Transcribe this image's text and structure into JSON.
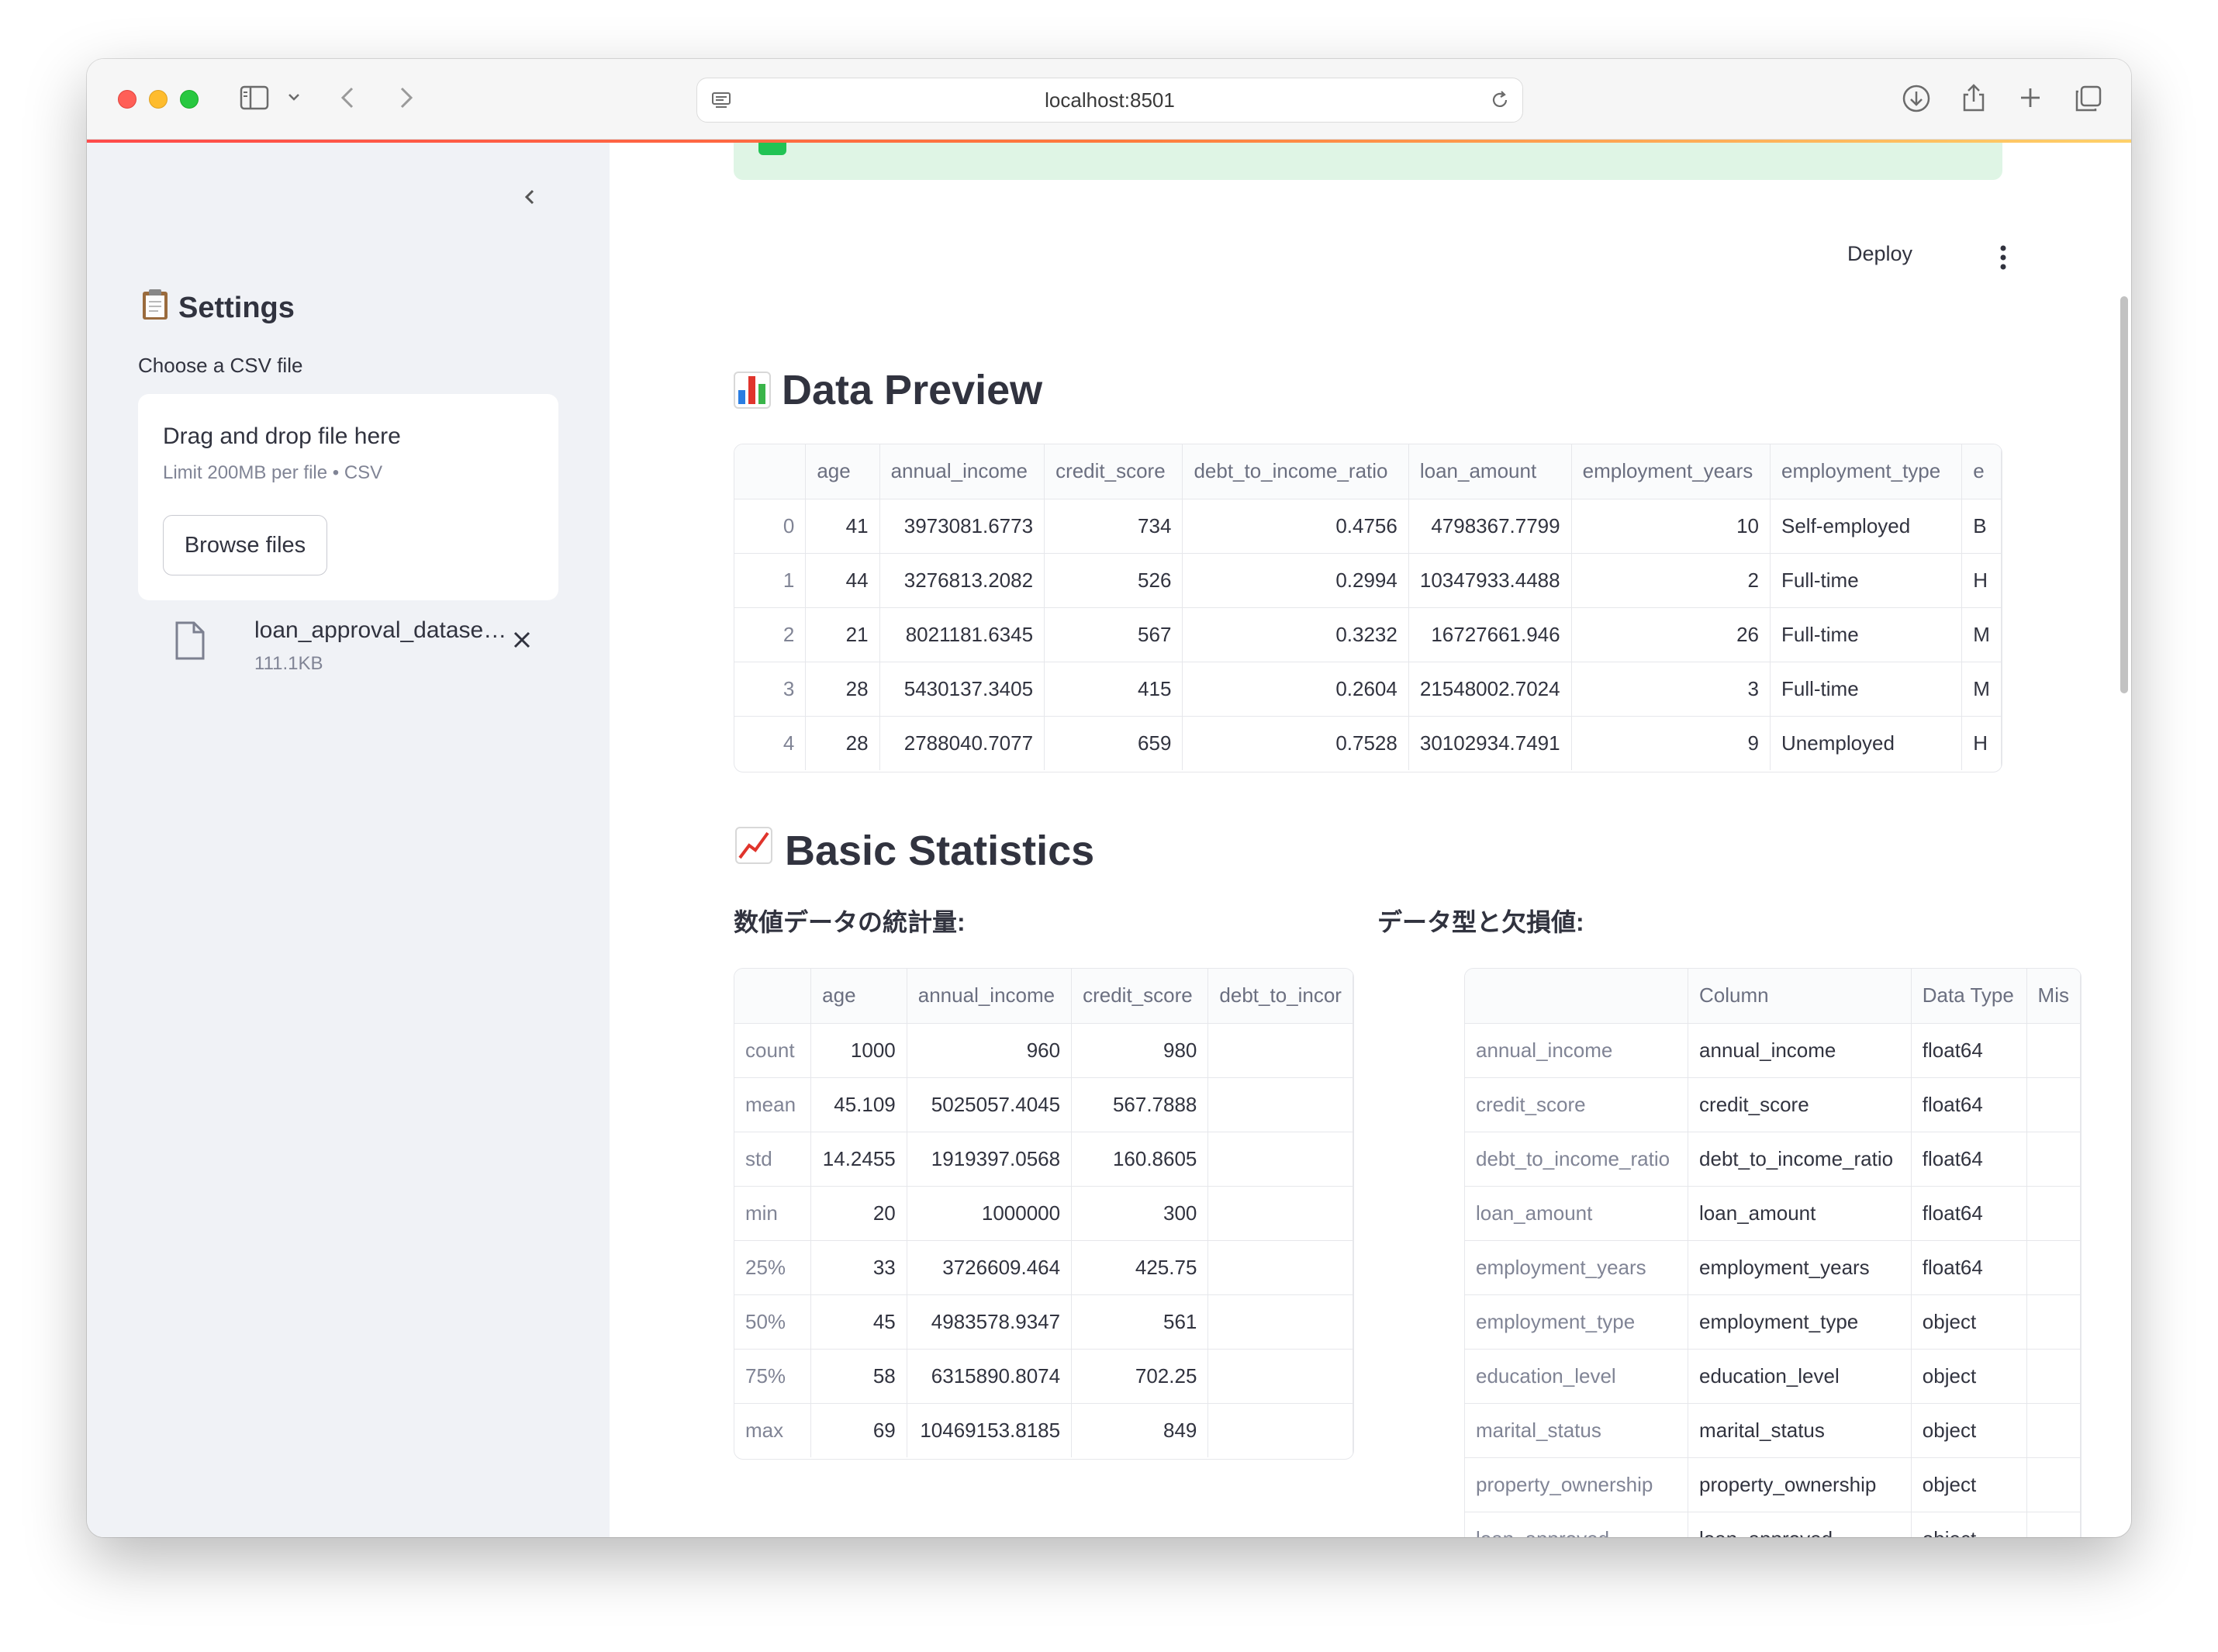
{
  "browser": {
    "url": "localhost:8501"
  },
  "sidebar": {
    "title": "Settings",
    "title_icon": "clipboard-icon",
    "uploader_label": "Choose a CSV file",
    "dropzone_text": "Drag and drop file here",
    "dropzone_limit": "Limit 200MB per file • CSV",
    "browse_label": "Browse files",
    "file": {
      "name": "loan_approval_datase…",
      "size": "111.1KB"
    }
  },
  "header": {
    "deploy_label": "Deploy"
  },
  "data_preview": {
    "title": "Data Preview",
    "title_icon": "bar-chart-icon",
    "columns": [
      "",
      "age",
      "annual_income",
      "credit_score",
      "debt_to_income_ratio",
      "loan_amount",
      "employment_years",
      "employment_type",
      "e"
    ],
    "rows": [
      [
        "0",
        "41",
        "3973081.6773",
        "734",
        "0.4756",
        "4798367.7799",
        "10",
        "Self-employed",
        "B"
      ],
      [
        "1",
        "44",
        "3276813.2082",
        "526",
        "0.2994",
        "10347933.4488",
        "2",
        "Full-time",
        "H"
      ],
      [
        "2",
        "21",
        "8021181.6345",
        "567",
        "0.3232",
        "16727661.946",
        "26",
        "Full-time",
        "M"
      ],
      [
        "3",
        "28",
        "5430137.3405",
        "415",
        "0.2604",
        "21548002.7024",
        "3",
        "Full-time",
        "M"
      ],
      [
        "4",
        "28",
        "2788040.7077",
        "659",
        "0.7528",
        "30102934.7491",
        "9",
        "Unemployed",
        "H"
      ]
    ]
  },
  "basic_stats": {
    "title": "Basic Statistics",
    "title_icon": "trend-chart-icon",
    "numeric_heading": "数値データの統計量:",
    "dtype_heading": "データ型と欠損値:",
    "numeric_columns": [
      "",
      "age",
      "annual_income",
      "credit_score",
      "debt_to_incor"
    ],
    "numeric_rows": [
      [
        "count",
        "1000",
        "960",
        "980",
        ""
      ],
      [
        "mean",
        "45.109",
        "5025057.4045",
        "567.7888",
        ""
      ],
      [
        "std",
        "14.2455",
        "1919397.0568",
        "160.8605",
        ""
      ],
      [
        "min",
        "20",
        "1000000",
        "300",
        ""
      ],
      [
        "25%",
        "33",
        "3726609.464",
        "425.75",
        ""
      ],
      [
        "50%",
        "45",
        "4983578.9347",
        "561",
        ""
      ],
      [
        "75%",
        "58",
        "6315890.8074",
        "702.25",
        ""
      ],
      [
        "max",
        "69",
        "10469153.8185",
        "849",
        ""
      ]
    ],
    "dtype_columns": [
      "",
      "Column",
      "Data Type",
      "Mis"
    ],
    "dtype_rows": [
      [
        "annual_income",
        "annual_income",
        "float64",
        ""
      ],
      [
        "credit_score",
        "credit_score",
        "float64",
        ""
      ],
      [
        "debt_to_income_ratio",
        "debt_to_income_ratio",
        "float64",
        ""
      ],
      [
        "loan_amount",
        "loan_amount",
        "float64",
        ""
      ],
      [
        "employment_years",
        "employment_years",
        "float64",
        ""
      ],
      [
        "employment_type",
        "employment_type",
        "object",
        ""
      ],
      [
        "education_level",
        "education_level",
        "object",
        ""
      ],
      [
        "marital_status",
        "marital_status",
        "object",
        ""
      ],
      [
        "property_ownership",
        "property_ownership",
        "object",
        ""
      ],
      [
        "loan_approved",
        "loan_approved",
        "object",
        ""
      ]
    ]
  }
}
